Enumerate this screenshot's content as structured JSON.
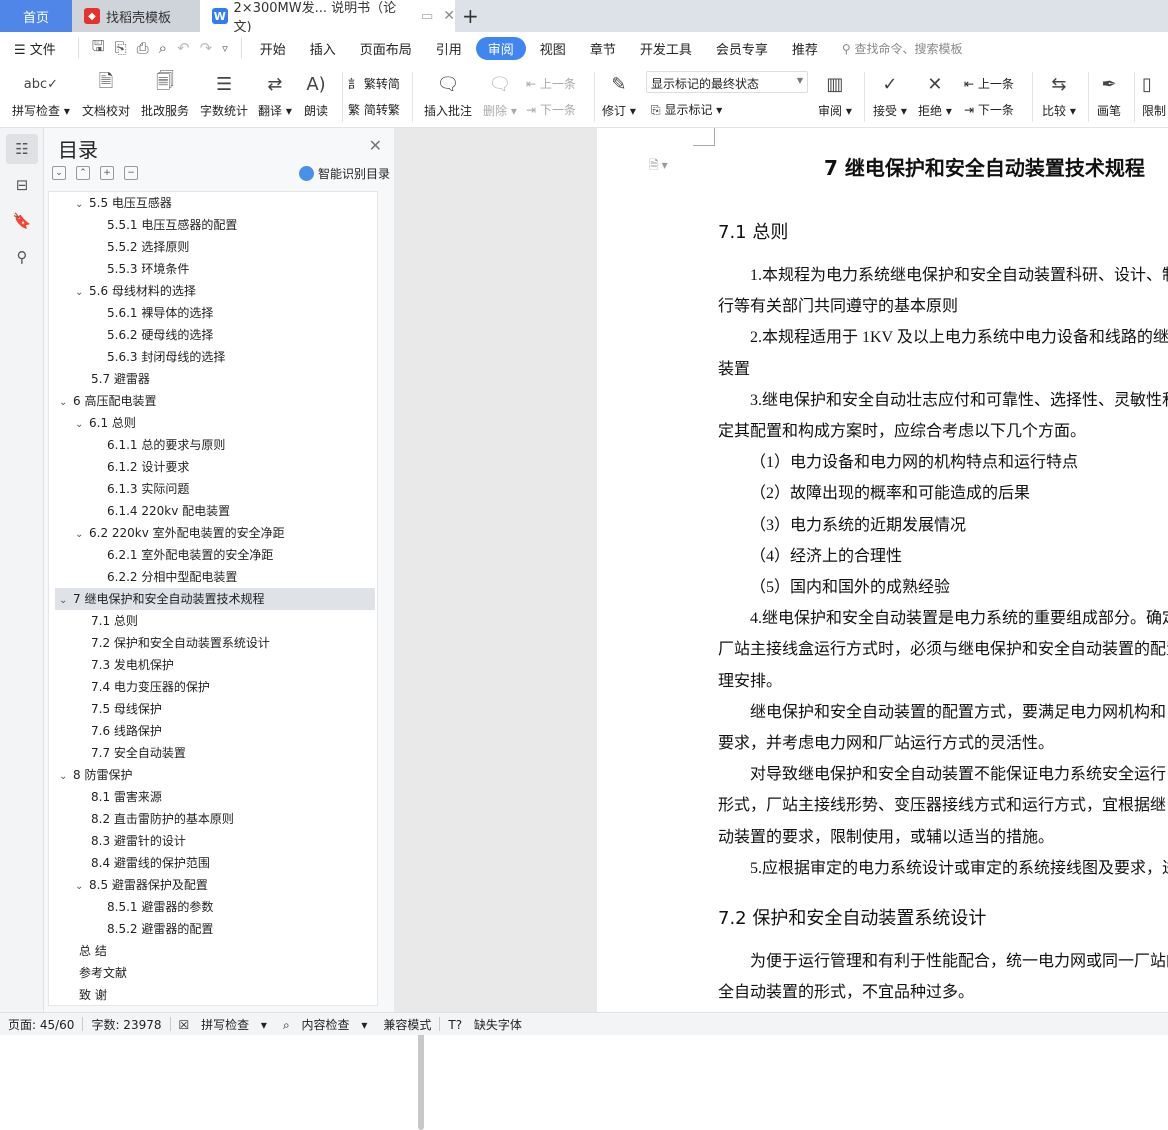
{
  "tabs": [
    {
      "label": "首页"
    },
    {
      "label": "找稻壳模板",
      "icon": "docer-icon"
    },
    {
      "label": "2×300MW发... 说明书（论文)",
      "icon": "wps-writer-icon"
    }
  ],
  "menu": {
    "file": "文件",
    "items": [
      "开始",
      "插入",
      "页面布局",
      "引用",
      "审阅",
      "视图",
      "章节",
      "开发工具",
      "会员专享",
      "推荐"
    ],
    "active": "审阅",
    "search_placeholder": "查找命令、搜索模板"
  },
  "ribbon": {
    "spell": "拼写检查",
    "proof": "文档校对",
    "correct": "批改服务",
    "wordcount": "字数统计",
    "translate": "翻译",
    "read": "朗读",
    "t2s": "繁转简",
    "s2t": "简转繁",
    "insert_comment": "插入批注",
    "delete": "删除",
    "prev": "上一条",
    "next": "下一条",
    "revise": "修订",
    "mark_state": "显示标记的最终状态",
    "show_marks": "显示标记",
    "review": "审阅",
    "accept": "接受",
    "reject": "拒绝",
    "prev2": "上一条",
    "next2": "下一条",
    "compare": "比较",
    "pen": "画笔",
    "restrict": "限制"
  },
  "toc": {
    "title": "目录",
    "smart": "智能识别目录",
    "items": [
      {
        "t": "5.5 电压互感器",
        "l": 2,
        "c": true
      },
      {
        "t": "5.5.1 电压互感器的配置",
        "l": 3
      },
      {
        "t": "5.5.2  选择原则",
        "l": 3
      },
      {
        "t": "5.5.3 环境条件",
        "l": 3
      },
      {
        "t": "5.6 母线材料的选择",
        "l": 2,
        "c": true
      },
      {
        "t": "5.6.1 裸导体的选择",
        "l": 3
      },
      {
        "t": "5.6.2 硬母线的选择",
        "l": 3
      },
      {
        "t": "5.6.3 封闭母线的选择",
        "l": 3
      },
      {
        "t": "5.7 避雷器",
        "l": 2
      },
      {
        "t": "6  高压配电装置",
        "l": 1,
        "c": true
      },
      {
        "t": "6.1 总则",
        "l": 2,
        "c": true
      },
      {
        "t": "6.1.1 总的要求与原则",
        "l": 3
      },
      {
        "t": "6.1.2 设计要求",
        "l": 3
      },
      {
        "t": "6.1.3 实际问题",
        "l": 3
      },
      {
        "t": "6.1.4 220kv 配电装置",
        "l": 3
      },
      {
        "t": "6.2 220kv 室外配电装置的安全净距",
        "l": 2,
        "c": true
      },
      {
        "t": "6.2.1 室外配电装置的安全净距",
        "l": 3
      },
      {
        "t": "6.2.2 分相中型配电装置",
        "l": 3
      },
      {
        "t": "7  继电保护和安全自动装置技术规程",
        "l": 1,
        "c": true,
        "sel": true
      },
      {
        "t": "7.1 总则",
        "l": 2
      },
      {
        "t": "7.2 保护和安全自动装置系统设计",
        "l": 2
      },
      {
        "t": "7.3 发电机保护",
        "l": 2
      },
      {
        "t": "7.4 电力变压器的保护",
        "l": 2
      },
      {
        "t": "7.5 母线保护",
        "l": 2
      },
      {
        "t": "7.6 线路保护",
        "l": 2
      },
      {
        "t": "7.7 安全自动装置",
        "l": 2
      },
      {
        "t": "8  防雷保护",
        "l": 1,
        "c": true
      },
      {
        "t": "8.1 雷害来源",
        "l": 2
      },
      {
        "t": "8.2 直击雷防护的基本原则",
        "l": 2
      },
      {
        "t": "8.3 避雷针的设计",
        "l": 2
      },
      {
        "t": "8.4 避雷线的保护范围",
        "l": 2
      },
      {
        "t": "8.5 避雷器保护及配置",
        "l": 2,
        "c": true
      },
      {
        "t": "8.5.1 避雷器的参数",
        "l": 3
      },
      {
        "t": "8.5.2 避雷器的配置",
        "l": 3
      },
      {
        "t": "总    结",
        "l": 0
      },
      {
        "t": "参考文献",
        "l": 0
      },
      {
        "t": "致    谢",
        "l": 0
      }
    ]
  },
  "doc": {
    "title": "7  继电保护和安全自动装置技术规程",
    "h71": "7.1 总则",
    "lines": [
      {
        "t": "1.本规程为电力系统继电保护和安全自动装置科研、设计、制",
        "i": 1
      },
      {
        "t": "行等有关部门共同遵守的基本原则",
        "i": 0
      },
      {
        "t": "2.本规程适用于 1KV 及以上电力系统中电力设备和线路的继",
        "i": 1
      },
      {
        "t": "装置",
        "i": 0
      },
      {
        "t": "3.继电保护和安全自动壮志应付和可靠性、选择性、灵敏性和",
        "i": 1
      },
      {
        "t": "定其配置和构成方案时，应综合考虑以下几个方面。",
        "i": 0
      },
      {
        "t": "（1）电力设备和电力网的机构特点和运行特点",
        "i": 1
      },
      {
        "t": "（2）故障出现的概率和可能造成的后果",
        "i": 1
      },
      {
        "t": "（3）电力系统的近期发展情况",
        "i": 1
      },
      {
        "t": "（4）经济上的合理性",
        "i": 1
      },
      {
        "t": "（5）国内和国外的成熟经验",
        "i": 1
      },
      {
        "t": "4.继电保护和安全自动装置是电力系统的重要组成部分。确定",
        "i": 1
      },
      {
        "t": "厂站主接线盒运行方式时，必须与继电保护和安全自动装置的配置",
        "i": 0
      },
      {
        "t": "理安排。",
        "i": 0
      },
      {
        "t": " 继电保护和安全自动装置的配置方式，要满足电力网机构和",
        "i": 1
      },
      {
        "t": "要求，并考虑电力网和厂站运行方式的灵活性。",
        "i": 0
      },
      {
        "t": "对导致继电保护和安全自动装置不能保证电力系统安全运行",
        "i": 1
      },
      {
        "t": "形式，厂站主接线形势、变压器接线方式和运行方式，宜根据继电",
        "i": 0
      },
      {
        "t": "动装置的要求，限制使用，或辅以适当的措施。",
        "i": 0
      },
      {
        "t": "5.应根据审定的电力系统设计或审定的系统接线图及要求，进",
        "i": 1
      }
    ],
    "h72": "7.2 保护和安全自动装置系统设计",
    "lines2": [
      {
        "t": "为便于运行管理和有利于性能配合，统一电力网或同一厂站的",
        "i": 1
      },
      {
        "t": "全自动装置的形式，不宜品种过多。",
        "i": 0
      }
    ]
  },
  "status": {
    "page": "页面: 45/60",
    "words": "字数: 23978",
    "spell": "拼写检查",
    "content": "内容检查",
    "compat": "兼容模式",
    "font": "缺失字体"
  },
  "colors": {
    "accent": "#3f86f0",
    "home_tab": "#4f86e8"
  }
}
